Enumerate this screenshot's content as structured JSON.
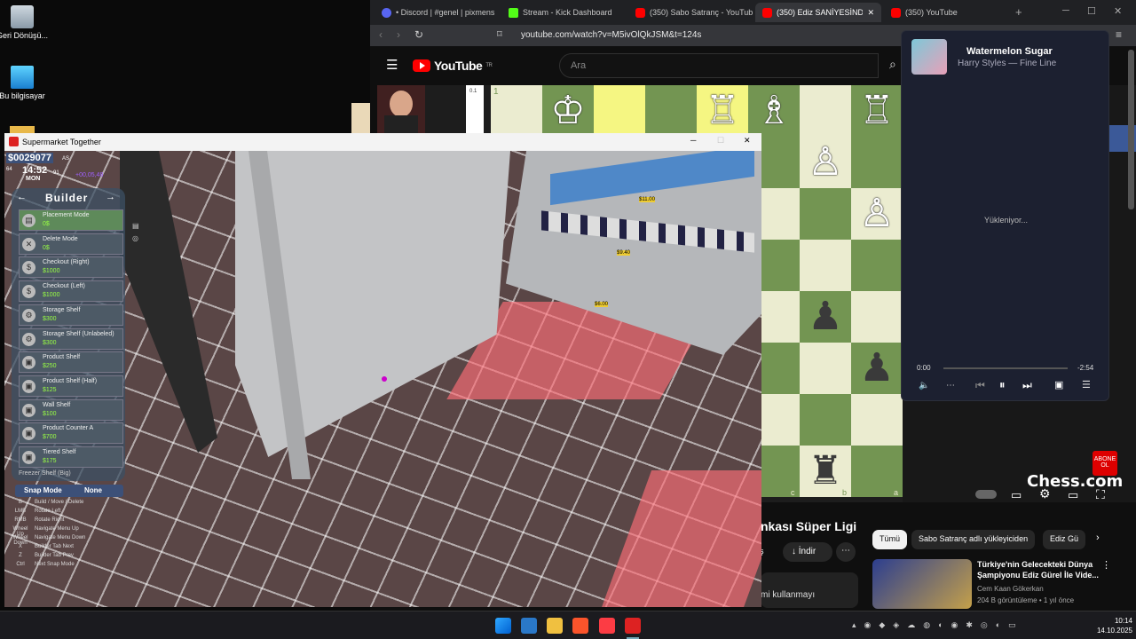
{
  "desktop": {
    "icons": [
      {
        "label": "Geri Dönüşü...",
        "icon": "recycle-bin-icon"
      },
      {
        "label": "Bu bilgisayar",
        "icon": "computer-icon"
      }
    ]
  },
  "browser": {
    "tabs": [
      {
        "label": "• Discord | #genel | pixmens",
        "color": "#5865f2"
      },
      {
        "label": "Stream - Kick Dashboard",
        "color": "#53fc18"
      },
      {
        "label": "(350) Sabo Satranç - YouTube",
        "color": "#ff0000"
      },
      {
        "label": "(350) Ediz SANİYESİNDE M",
        "color": "#ff0000"
      },
      {
        "label": "(350) YouTube",
        "color": "#ff0000"
      }
    ],
    "url": "youtube.com/watch?v=M5ivOlQkJSM&t=124s"
  },
  "youtube": {
    "logo": "YouTube",
    "region": "TR",
    "search_placeholder": "Ara",
    "video_title_fragment": "nkası Süper Ligi",
    "download_label": "İndir",
    "share_fragment": "aş",
    "comment_fragment": "mi kullanmayı",
    "chips": [
      "Tümü",
      "Sabo Satranç adlı yükleyiciden",
      "Ediz Gü"
    ],
    "rec_title": "Türkiye'nin Gelecekteki Dünya Şampiyonu Ediz Gürel İle Vide...",
    "rec_channel": "Cem Kaan Gökerkan",
    "rec_meta": "204 B görüntüleme • 1 yıl önce",
    "chess_watermark": "Chess.com",
    "abone_badge": "ABONE OL",
    "board_labels": {
      "c": "c",
      "b": "b",
      "a": "a",
      "rank1": "1"
    },
    "eval_value": "0.1"
  },
  "media": {
    "title": "Watermelon Sugar",
    "artist": "Harry Styles — Fine Line",
    "loading": "Yükleniyor...",
    "time_current": "0:00",
    "time_remaining": "-2:54"
  },
  "game": {
    "window_title": "Supermarket Together",
    "money": "$0029077",
    "time": "14:52",
    "day": "MON",
    "side_small_a": "64",
    "side_small_b": "91",
    "side_small_c": "AS",
    "floating_text": "+00,05,48",
    "builder_title": "Builder",
    "items": [
      {
        "name": "Placement Mode",
        "price": "0$",
        "icon": "cart-icon"
      },
      {
        "name": "Delete Mode",
        "price": "0$",
        "icon": "delete-icon"
      },
      {
        "name": "Checkout (Right)",
        "price": "$1000",
        "icon": "dollar-icon"
      },
      {
        "name": "Checkout (Left)",
        "price": "$1000",
        "icon": "dollar-icon"
      },
      {
        "name": "Storage Shelf",
        "price": "$300",
        "icon": "gears-icon"
      },
      {
        "name": "Storage Shelf (Unlabeled)",
        "price": "$300",
        "icon": "gears-icon"
      },
      {
        "name": "Product Shelf",
        "price": "$250",
        "icon": "box-icon"
      },
      {
        "name": "Product Shelf (Half)",
        "price": "$125",
        "icon": "box-icon"
      },
      {
        "name": "Wall Shelf",
        "price": "$100",
        "icon": "box-icon"
      },
      {
        "name": "Product Counter A",
        "price": "$700",
        "icon": "box-icon"
      },
      {
        "name": "Tiered Shelf",
        "price": "$175",
        "icon": "box-icon"
      }
    ],
    "partial_item": "Freezer Shelf (Big)",
    "snap_label": "Snap Mode",
    "snap_value": "None",
    "hotkeys": [
      {
        "key": "B",
        "action": "Build / Move / Delete"
      },
      {
        "key": "LMB",
        "action": "Rotate Left"
      },
      {
        "key": "RMB",
        "action": "Rotate Right"
      },
      {
        "key": "Wheel Up",
        "action": "Navigate Menu Up"
      },
      {
        "key": "Wheel Down",
        "action": "Navigate Menu Down"
      },
      {
        "key": "X",
        "action": "Builder Tab Next"
      },
      {
        "key": "Z",
        "action": "Builder Tab Prev"
      },
      {
        "key": "Ctrl",
        "action": "Next Snap Mode"
      }
    ],
    "price_tags": [
      "$11.00",
      "$9.40",
      "$6.00"
    ]
  },
  "taskbar": {
    "time": "10:14",
    "date": "14.10.2025"
  }
}
